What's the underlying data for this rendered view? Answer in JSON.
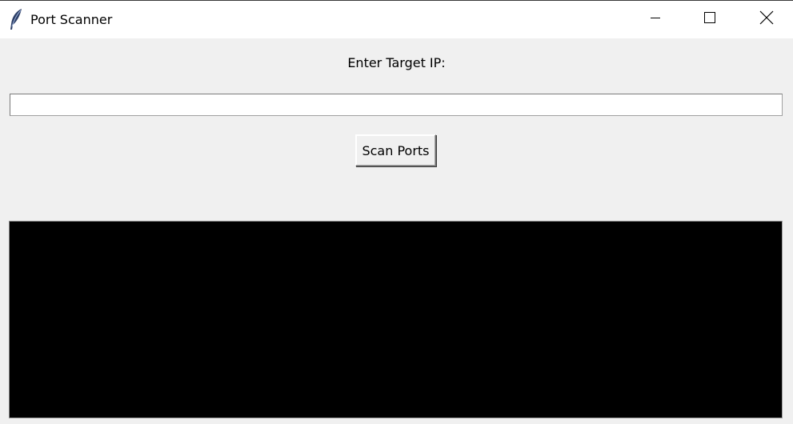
{
  "window": {
    "title": "Port Scanner",
    "icon": "feather-icon",
    "controls": {
      "minimize_icon": "minimize-icon",
      "maximize_icon": "maximize-icon",
      "close_icon": "close-icon"
    }
  },
  "form": {
    "prompt_label": "Enter Target IP:",
    "ip_value": "",
    "scan_button_label": "Scan Ports"
  },
  "output": {
    "text": "",
    "background": "#000000"
  },
  "colors": {
    "window_background": "#f0f0f0",
    "titlebar_background": "#ffffff"
  }
}
